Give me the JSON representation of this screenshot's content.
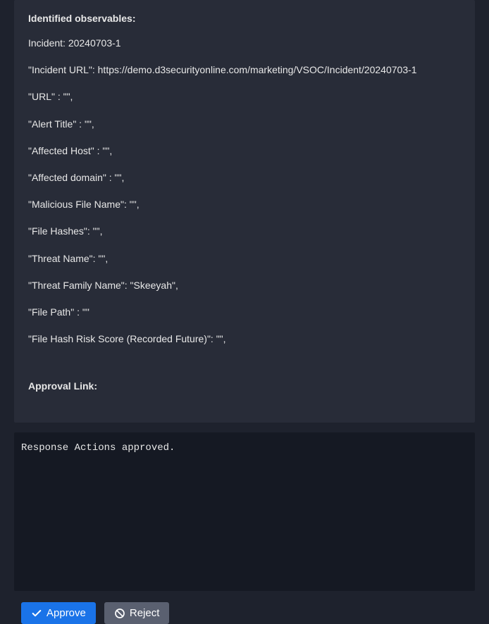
{
  "observables": {
    "heading": "Identified observables:",
    "lines": [
      "Incident: 20240703-1",
      "\"Incident URL\": https://demo.d3securityonline.com/marketing/VSOC/Incident/20240703-1",
      "\"URL\" : \"\",",
      "\"Alert Title\" : \"\",",
      "\"Affected Host\" : \"\",",
      "\"Affected domain\" : \"\",",
      "\"Malicious File Name\": \"\",",
      "\"File Hashes\": \"\",",
      "\"Threat Name\": \"\",",
      "\"Threat Family Name\": \"Skeeyah\",",
      "\"File Path\" : \"\"",
      "\"File Hash Risk Score (Recorded Future)\": \"\","
    ],
    "approval_heading": "Approval Link:"
  },
  "response": {
    "text": "Response Actions approved."
  },
  "buttons": {
    "approve_label": "Approve",
    "reject_label": "Reject"
  },
  "colors": {
    "bg_outer": "#1e222d",
    "bg_panel": "#282c38",
    "bg_response": "#151923",
    "btn_primary": "#1a73e8",
    "btn_secondary": "#5a6070",
    "text": "#e8e8e8"
  }
}
